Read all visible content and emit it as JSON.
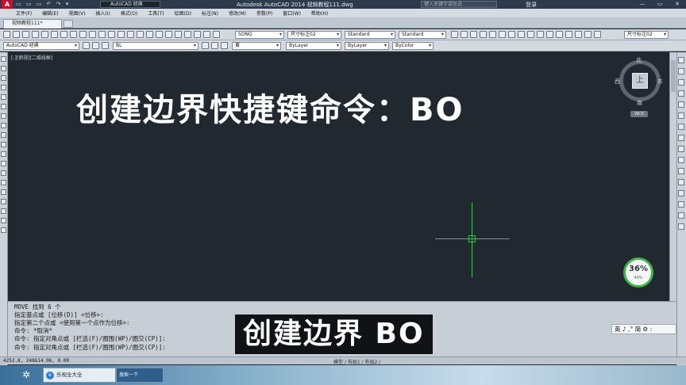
{
  "titlebar": {
    "logo": "A",
    "quick_access": "▭ ▭ ▭ ↶ ↷ ▾",
    "workspace": "AutoCAD 经典",
    "title": "Autodesk AutoCAD 2014    视频教程111.dwg",
    "search_placeholder": "键入关键字或短语",
    "login": "登录",
    "controls": [
      "—",
      "▭",
      "✕"
    ]
  },
  "menubar": {
    "items": [
      "文件(F)",
      "编辑(E)",
      "视图(V)",
      "插入(I)",
      "格式(O)",
      "工具(T)",
      "绘图(D)",
      "标注(N)",
      "修改(M)",
      "参数(P)",
      "窗口(W)",
      "帮助(H)"
    ]
  },
  "tabs": {
    "active": "视频教程111*"
  },
  "toolbar1": {
    "text_style": "SONG",
    "dim_label": "尺寸标注02",
    "table_style": "Standard",
    "multileader_style": "Standard",
    "dim_label_right": "尺寸标注02"
  },
  "toolbar2": {
    "workspace": "AutoCAD 经典",
    "layer": "BL",
    "color": "黄",
    "linetype": "ByLayer",
    "lineweight": "ByLayer",
    "plotstyle": "ByColor"
  },
  "canvas": {
    "view_label": "[-][俯视][二维线框]",
    "heading": "创建边界快捷键命令：BO"
  },
  "viewcube": {
    "top_face": "上",
    "north": "北",
    "south": "南",
    "east": "东",
    "west": "西",
    "wcs": "WCS"
  },
  "badge": {
    "percent": "36%",
    "sub": "49%"
  },
  "command": {
    "lines": [
      "MOVE 找到 6 个",
      "指定基点或 [位移(D)] <位移>:",
      "指定第二个点或 <使用第一个点作为位移>:",
      "命令: *取消*",
      "命令: 指定对角点或 [栏选(F)/圈围(WP)/圈交(CP)]:",
      "命令: 指定对角点或 [栏选(F)/圈围(WP)/圈交(CP)]:"
    ]
  },
  "subtitle": "创建边界 BO",
  "ime": "英 ♪ ,° 简 ⚙ :",
  "statusbar": {
    "coords": "4252.8, 248614.96, 0.00",
    "model": "模型 / 布局1 / 布局2 /"
  },
  "taskbar": {
    "app_label": "乐视全大全",
    "search_label": "搜索一下"
  },
  "colors": {
    "canvas_bg": "#212830",
    "crosshair": "#35c05a",
    "cmd_bg": "#c8ced5"
  }
}
